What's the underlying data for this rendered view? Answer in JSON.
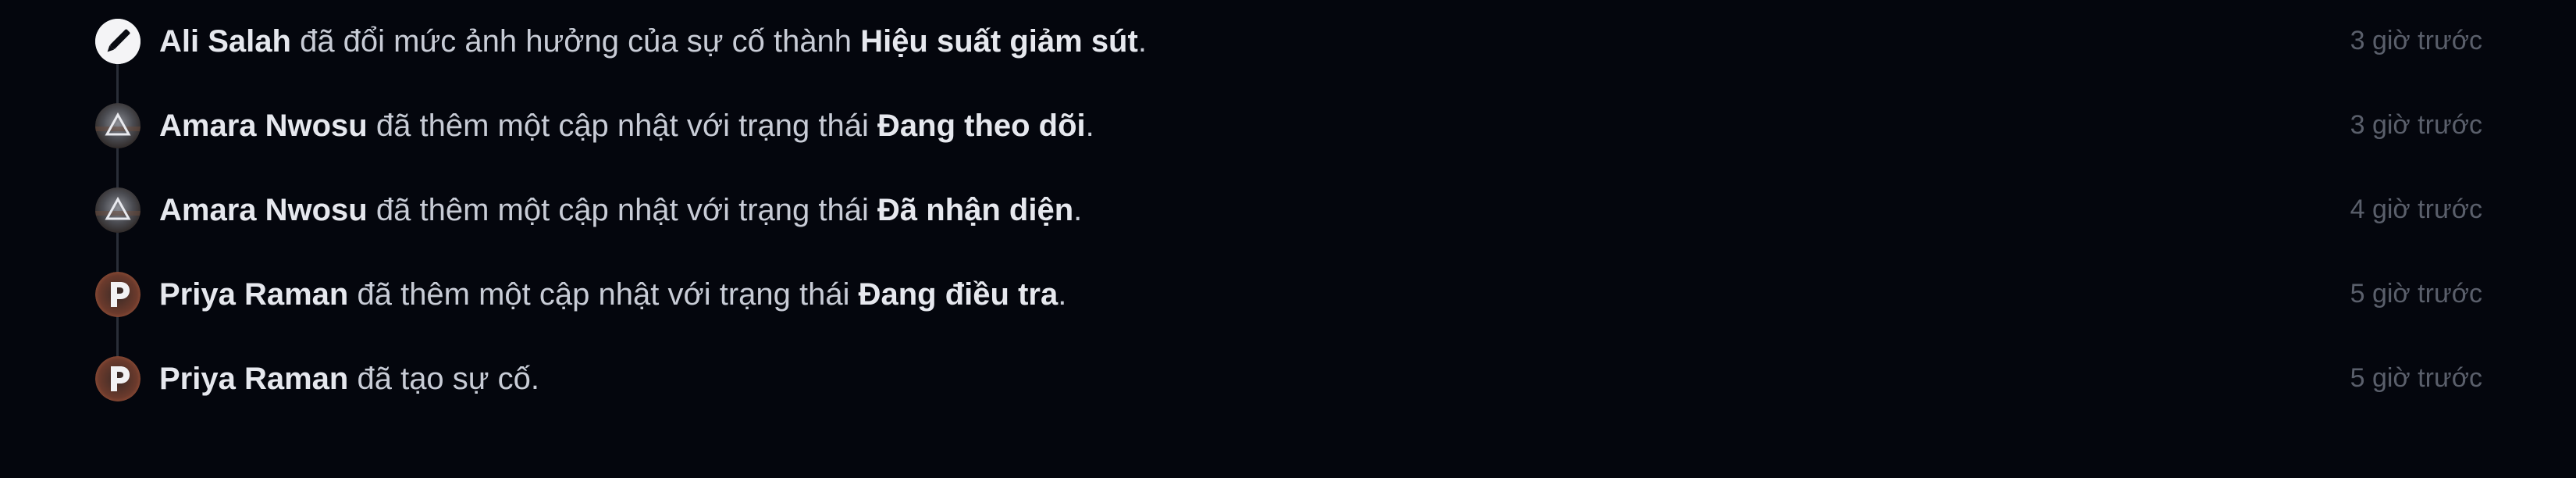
{
  "activity": {
    "items": [
      {
        "avatar_icon": "pencil-icon",
        "actor": "Ali Salah",
        "action": "đã đổi mức ảnh hưởng của sự cố thành",
        "value": "Hiệu suất giảm sút",
        "end": ".",
        "time": "3 giờ trước"
      },
      {
        "avatar_icon": "avatar-amara-nwosu",
        "actor": "Amara Nwosu",
        "action": "đã thêm một cập nhật với trạng thái",
        "value": "Đang theo dõi",
        "end": ".",
        "time": "3 giờ trước"
      },
      {
        "avatar_icon": "avatar-amara-nwosu",
        "actor": "Amara Nwosu",
        "action": "đã thêm một cập nhật với trạng thái",
        "value": "Đã nhận diện",
        "end": ".",
        "time": "4 giờ trước"
      },
      {
        "avatar_icon": "avatar-priya-raman",
        "actor": "Priya Raman",
        "action": "đã thêm một cập nhật với trạng thái",
        "value": "Đang điều tra",
        "end": ".",
        "time": "5 giờ trước"
      },
      {
        "avatar_icon": "avatar-priya-raman",
        "actor": "Priya Raman",
        "action": "đã tạo sự cố.",
        "value": "",
        "end": "",
        "time": "5 giờ trước"
      }
    ]
  },
  "colors": {
    "background": "#04060d",
    "text": "#c8ccd6",
    "text_strong": "#e6e8ee",
    "muted": "#5a5f6b",
    "rail": "#2a2e38"
  }
}
